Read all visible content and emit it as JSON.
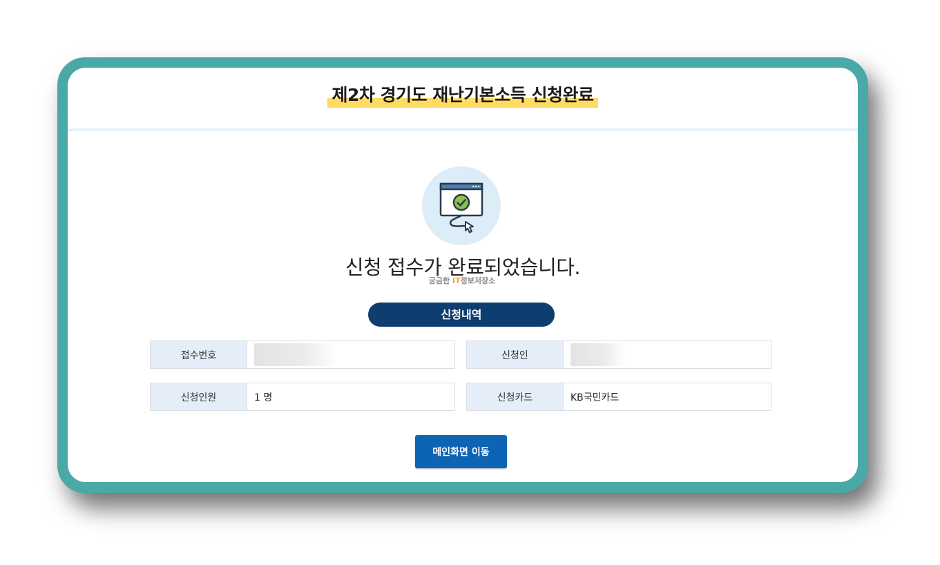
{
  "header": {
    "title": "제2차 경기도 재난기본소득 신청완료"
  },
  "status": {
    "message": "신청 접수가 완료되었습니다."
  },
  "watermark": {
    "prefix": "궁금한 ",
    "it": "IT",
    "suffix": "정보저장소"
  },
  "section": {
    "title": "신청내역"
  },
  "details": {
    "receipt_no_label": "접수번호",
    "receipt_no_value": "",
    "applicant_label": "신청인",
    "applicant_value": "",
    "applicant_count_label": "신청인원",
    "applicant_count_value": "1 명",
    "card_label": "신청카드",
    "card_value": "KB국민카드"
  },
  "actions": {
    "main_button": "메인화면 이동"
  },
  "colors": {
    "frame": "#4aa8a6",
    "title_highlight": "#fedc63",
    "pill": "#0d3e6f",
    "button": "#0d63b4",
    "label_bg": "#e5eef8"
  },
  "icons": [
    "browser-check-icon",
    "cursor-icon"
  ]
}
